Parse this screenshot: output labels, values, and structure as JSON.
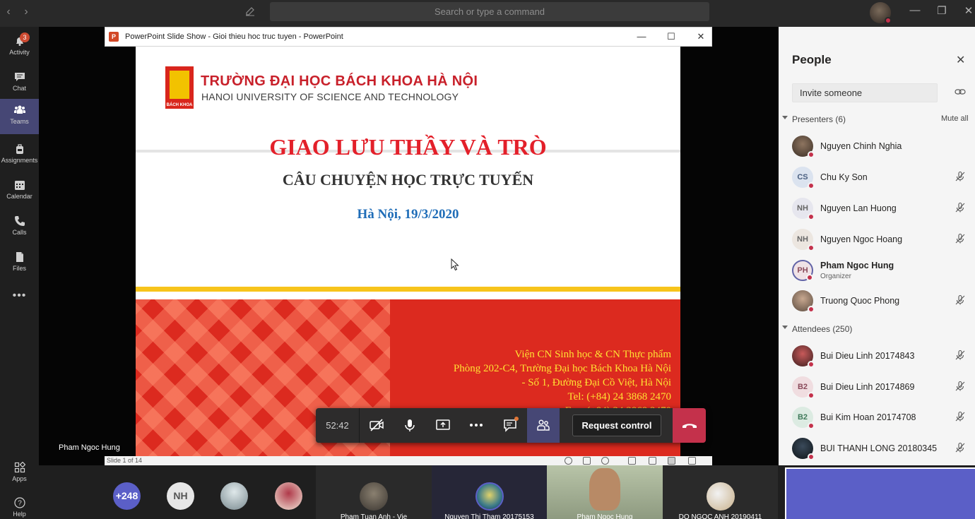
{
  "titlebar": {
    "search_placeholder": "Search or type a command",
    "back": "‹",
    "forward": "›",
    "minimize": "—",
    "restore": "❐",
    "close": "✕"
  },
  "rail": {
    "items": [
      {
        "label": "Activity",
        "badge": "3"
      },
      {
        "label": "Chat"
      },
      {
        "label": "Teams"
      },
      {
        "label": "Assignments"
      },
      {
        "label": "Calendar"
      },
      {
        "label": "Calls"
      },
      {
        "label": "Files"
      },
      {
        "label": "Apps"
      },
      {
        "label": "Help"
      }
    ],
    "more": "•••"
  },
  "ppt": {
    "window_title": "PowerPoint Slide Show  -  Gioi thieu hoc truc tuyen - PowerPoint",
    "logo_letter": "P",
    "minimize": "—",
    "maximize": "☐",
    "close": "✕",
    "status": "Slide 1 of 14"
  },
  "slide": {
    "uni_vn": "TRƯỜNG ĐẠI HỌC BÁCH KHOA HÀ NỘI",
    "uni_en": "HANOI UNIVERSITY OF SCIENCE AND TECHNOLOGY",
    "logo_text": "BÁCH KHOA",
    "title": "GIAO LƯU THẦY VÀ TRÒ",
    "subtitle": "CÂU CHUYỆN HỌC TRỰC TUYẾN",
    "date": "Hà Nội, 19/3/2020",
    "address": [
      "Viện CN Sinh học & CN Thực phẩm",
      "Phòng 202-C4, Trường Đại học Bách Khoa Hà Nội",
      "- Số 1, Đường Đại Cồ Việt, Hà Nội",
      "Tel: (+84) 24 3868 2470",
      "Fax: (+84) 24 3868 2470"
    ]
  },
  "stage": {
    "presenter_label": "Pham Ngoc Hung"
  },
  "controls": {
    "timer": "52:42",
    "request_control": "Request control"
  },
  "strip": {
    "overflow_count": "+248",
    "initials": "NH",
    "tiles": [
      {
        "name": "Pham Tuan Anh - Vie"
      },
      {
        "name": "Nguyen Thi Tham 20175153"
      },
      {
        "name": "Pham Ngoc Hung"
      },
      {
        "name": "DO NGOC ANH 20190411"
      }
    ]
  },
  "people": {
    "title": "People",
    "invite_placeholder": "Invite someone",
    "presenters_label": "Presenters (6)",
    "mute_all": "Mute all",
    "attendees_label": "Attendees (250)",
    "presenters": [
      {
        "name": "Nguyen Chinh Nghia",
        "initials": "",
        "photo": true
      },
      {
        "name": "Chu Ky Son",
        "initials": "CS"
      },
      {
        "name": "Nguyen Lan Huong",
        "initials": "NH"
      },
      {
        "name": "Nguyen Ngoc Hoang",
        "initials": "NH"
      },
      {
        "name": "Pham Ngoc Hung",
        "initials": "PH",
        "role": "Organizer"
      },
      {
        "name": "Truong Quoc Phong",
        "initials": "",
        "photo": true
      }
    ],
    "attendees": [
      {
        "name": "Bui Dieu Linh 20174843",
        "initials": "",
        "photo": true
      },
      {
        "name": "Bui Dieu Linh 20174869",
        "initials": "B2"
      },
      {
        "name": "Bui Kim Hoan 20174708",
        "initials": "B2"
      },
      {
        "name": "BUI THANH LONG 20180345",
        "initials": "",
        "photo": true
      }
    ]
  },
  "colors": {
    "teams_purple": "#464775",
    "hangup_red": "#c4314b",
    "slide_red": "#dc2a1f",
    "slide_yellow": "#f7c41b",
    "status_red": "#c4314b"
  }
}
